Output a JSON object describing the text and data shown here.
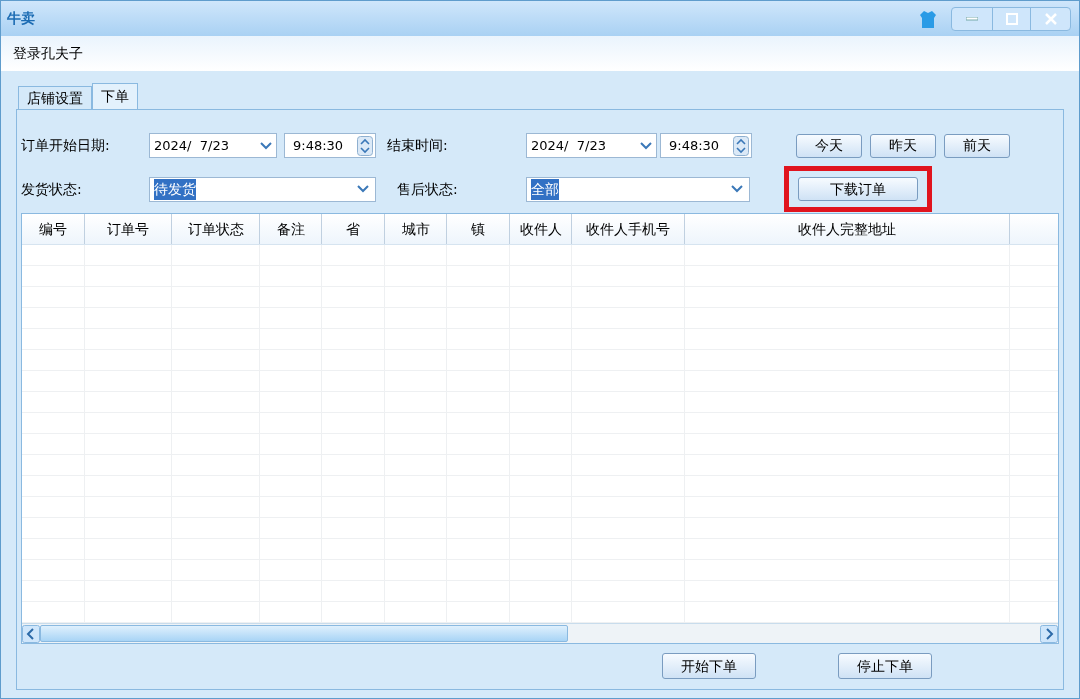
{
  "window": {
    "title": "牛卖"
  },
  "login_text": "登录孔夫子",
  "tabs": [
    {
      "label": "店铺设置",
      "selected": false
    },
    {
      "label": "下单",
      "selected": true
    }
  ],
  "form": {
    "start_label": "订单开始日期:",
    "start_date": "2024/  7/23",
    "start_time": "9:48:30",
    "end_label": "结束时间:",
    "end_date": "2024/  7/23",
    "end_time": "9:48:30",
    "quick_buttons": [
      "今天",
      "昨天",
      "前天"
    ],
    "ship_label": "发货状态:",
    "ship_status": {
      "value": "待发货",
      "text_selected": true
    },
    "after_label": "售后状态:",
    "after_status": {
      "value": "全部",
      "text_selected": true
    },
    "download_button": {
      "label": "下载订单",
      "highlighted": true
    }
  },
  "table": {
    "columns": [
      "编号",
      "订单号",
      "订单状态",
      "备注",
      "省",
      "城市",
      "镇",
      "收件人",
      "收件人手机号",
      "收件人完整地址"
    ]
  },
  "footer_buttons": [
    "开始下单",
    "停止下单"
  ]
}
